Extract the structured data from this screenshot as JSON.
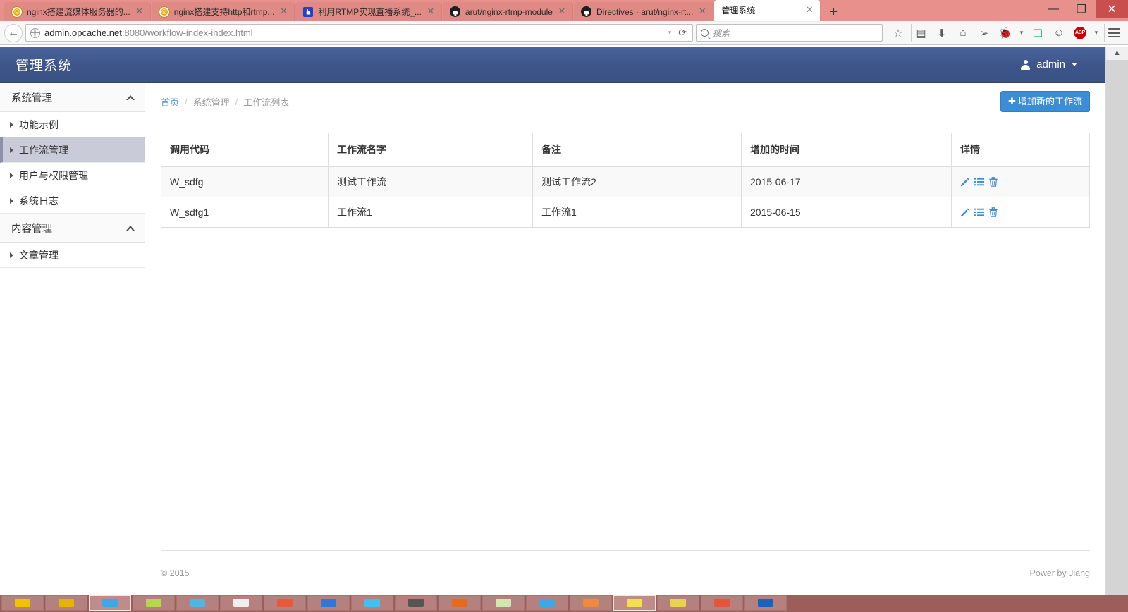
{
  "browser": {
    "tabs": [
      {
        "title": "nginx搭建流媒体服务器的...",
        "favicon": "circle-icon",
        "active": false,
        "close_label": "✕"
      },
      {
        "title": "nginx搭建支持http和rtmp...",
        "favicon": "circle-icon",
        "active": false,
        "close_label": "✕"
      },
      {
        "title": "利用RTMP实现直播系统_...",
        "favicon": "baidu-icon",
        "active": false,
        "close_label": "✕"
      },
      {
        "title": "arut/nginx-rtmp-module",
        "favicon": "github-icon",
        "active": false,
        "close_label": "✕"
      },
      {
        "title": "Directives · arut/nginx-rt...",
        "favicon": "github-icon",
        "active": false,
        "close_label": "✕"
      },
      {
        "title": "管理系统",
        "favicon": "none",
        "active": true,
        "close_label": "✕"
      }
    ],
    "new_tab_label": "+",
    "window_controls": {
      "minimize": "—",
      "restore": "❐",
      "close": "✕"
    },
    "nav": {
      "back_label": "←",
      "url_host": "admin.opcache.net",
      "url_rest": ":8080/workflow-index-index.html",
      "url_dropdown": "▾",
      "reload_label": "⟳"
    },
    "search": {
      "placeholder": "搜索",
      "value": ""
    },
    "toolbar_icons": [
      "star-icon",
      "reader-list-icon",
      "download-icon",
      "home-icon",
      "paper-plane-icon",
      "bug-icon",
      "dropdown-caret-icon",
      "puzzle-icon",
      "smiley-icon",
      "adblock-icon",
      "adblock-caret-icon",
      "hamburger-menu-icon"
    ],
    "adblock_label": "ABP"
  },
  "app": {
    "brand": "管理系统",
    "user": {
      "name": "admin",
      "caret": "▾"
    },
    "sidebar": {
      "groups": [
        {
          "label": "系统管理",
          "items": [
            {
              "label": "功能示例",
              "active": false
            },
            {
              "label": "工作流管理",
              "active": true
            },
            {
              "label": "用户与权限管理",
              "active": false
            },
            {
              "label": "系统日志",
              "active": false
            }
          ]
        },
        {
          "label": "内容管理",
          "items": [
            {
              "label": "文章管理",
              "active": false
            }
          ]
        }
      ]
    },
    "breadcrumb": {
      "home": "首页",
      "sep": "/",
      "section": "系统管理",
      "current": "工作流列表"
    },
    "add_button": {
      "icon": "✚",
      "label": "增加新的工作流"
    },
    "table": {
      "columns": [
        "调用代码",
        "工作流名字",
        "备注",
        "增加的时间",
        "详情"
      ],
      "rows": [
        {
          "code": "W_sdfg",
          "name": "测试工作流",
          "remark": "测试工作流2",
          "created": "2015-06-17",
          "actions": [
            "edit-icon",
            "detail-list-icon",
            "delete-icon"
          ]
        },
        {
          "code": "W_sdfg1",
          "name": "工作流1",
          "remark": "工作流1",
          "created": "2015-06-15",
          "actions": [
            "edit-icon",
            "detail-list-icon",
            "delete-icon"
          ]
        }
      ]
    },
    "footer": {
      "copyright": "© 2015",
      "credit": "Power by Jiang"
    }
  },
  "colors": {
    "header_blue": "#3d5489",
    "accent_blue": "#3b8ed6",
    "chrome_pink": "#e8918c",
    "active_sidebar": "#c9cbd8"
  }
}
